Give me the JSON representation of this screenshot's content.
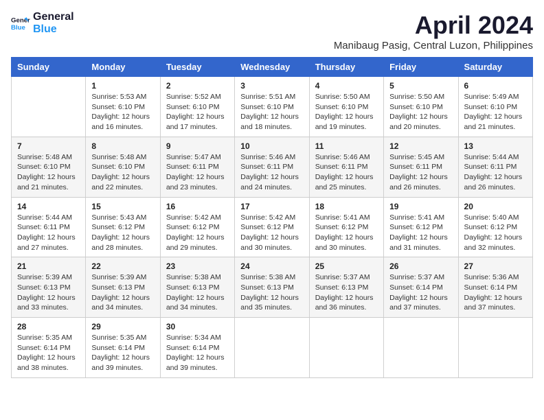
{
  "logo": {
    "line1": "General",
    "line2": "Blue"
  },
  "title": "April 2024",
  "subtitle": "Manibaug Pasig, Central Luzon, Philippines",
  "days_header": [
    "Sunday",
    "Monday",
    "Tuesday",
    "Wednesday",
    "Thursday",
    "Friday",
    "Saturday"
  ],
  "weeks": [
    [
      {
        "day": "",
        "sunrise": "",
        "sunset": "",
        "daylight": ""
      },
      {
        "day": "1",
        "sunrise": "Sunrise: 5:53 AM",
        "sunset": "Sunset: 6:10 PM",
        "daylight": "Daylight: 12 hours and 16 minutes."
      },
      {
        "day": "2",
        "sunrise": "Sunrise: 5:52 AM",
        "sunset": "Sunset: 6:10 PM",
        "daylight": "Daylight: 12 hours and 17 minutes."
      },
      {
        "day": "3",
        "sunrise": "Sunrise: 5:51 AM",
        "sunset": "Sunset: 6:10 PM",
        "daylight": "Daylight: 12 hours and 18 minutes."
      },
      {
        "day": "4",
        "sunrise": "Sunrise: 5:50 AM",
        "sunset": "Sunset: 6:10 PM",
        "daylight": "Daylight: 12 hours and 19 minutes."
      },
      {
        "day": "5",
        "sunrise": "Sunrise: 5:50 AM",
        "sunset": "Sunset: 6:10 PM",
        "daylight": "Daylight: 12 hours and 20 minutes."
      },
      {
        "day": "6",
        "sunrise": "Sunrise: 5:49 AM",
        "sunset": "Sunset: 6:10 PM",
        "daylight": "Daylight: 12 hours and 21 minutes."
      }
    ],
    [
      {
        "day": "7",
        "sunrise": "Sunrise: 5:48 AM",
        "sunset": "Sunset: 6:10 PM",
        "daylight": "Daylight: 12 hours and 21 minutes."
      },
      {
        "day": "8",
        "sunrise": "Sunrise: 5:48 AM",
        "sunset": "Sunset: 6:10 PM",
        "daylight": "Daylight: 12 hours and 22 minutes."
      },
      {
        "day": "9",
        "sunrise": "Sunrise: 5:47 AM",
        "sunset": "Sunset: 6:11 PM",
        "daylight": "Daylight: 12 hours and 23 minutes."
      },
      {
        "day": "10",
        "sunrise": "Sunrise: 5:46 AM",
        "sunset": "Sunset: 6:11 PM",
        "daylight": "Daylight: 12 hours and 24 minutes."
      },
      {
        "day": "11",
        "sunrise": "Sunrise: 5:46 AM",
        "sunset": "Sunset: 6:11 PM",
        "daylight": "Daylight: 12 hours and 25 minutes."
      },
      {
        "day": "12",
        "sunrise": "Sunrise: 5:45 AM",
        "sunset": "Sunset: 6:11 PM",
        "daylight": "Daylight: 12 hours and 26 minutes."
      },
      {
        "day": "13",
        "sunrise": "Sunrise: 5:44 AM",
        "sunset": "Sunset: 6:11 PM",
        "daylight": "Daylight: 12 hours and 26 minutes."
      }
    ],
    [
      {
        "day": "14",
        "sunrise": "Sunrise: 5:44 AM",
        "sunset": "Sunset: 6:11 PM",
        "daylight": "Daylight: 12 hours and 27 minutes."
      },
      {
        "day": "15",
        "sunrise": "Sunrise: 5:43 AM",
        "sunset": "Sunset: 6:12 PM",
        "daylight": "Daylight: 12 hours and 28 minutes."
      },
      {
        "day": "16",
        "sunrise": "Sunrise: 5:42 AM",
        "sunset": "Sunset: 6:12 PM",
        "daylight": "Daylight: 12 hours and 29 minutes."
      },
      {
        "day": "17",
        "sunrise": "Sunrise: 5:42 AM",
        "sunset": "Sunset: 6:12 PM",
        "daylight": "Daylight: 12 hours and 30 minutes."
      },
      {
        "day": "18",
        "sunrise": "Sunrise: 5:41 AM",
        "sunset": "Sunset: 6:12 PM",
        "daylight": "Daylight: 12 hours and 30 minutes."
      },
      {
        "day": "19",
        "sunrise": "Sunrise: 5:41 AM",
        "sunset": "Sunset: 6:12 PM",
        "daylight": "Daylight: 12 hours and 31 minutes."
      },
      {
        "day": "20",
        "sunrise": "Sunrise: 5:40 AM",
        "sunset": "Sunset: 6:12 PM",
        "daylight": "Daylight: 12 hours and 32 minutes."
      }
    ],
    [
      {
        "day": "21",
        "sunrise": "Sunrise: 5:39 AM",
        "sunset": "Sunset: 6:13 PM",
        "daylight": "Daylight: 12 hours and 33 minutes."
      },
      {
        "day": "22",
        "sunrise": "Sunrise: 5:39 AM",
        "sunset": "Sunset: 6:13 PM",
        "daylight": "Daylight: 12 hours and 34 minutes."
      },
      {
        "day": "23",
        "sunrise": "Sunrise: 5:38 AM",
        "sunset": "Sunset: 6:13 PM",
        "daylight": "Daylight: 12 hours and 34 minutes."
      },
      {
        "day": "24",
        "sunrise": "Sunrise: 5:38 AM",
        "sunset": "Sunset: 6:13 PM",
        "daylight": "Daylight: 12 hours and 35 minutes."
      },
      {
        "day": "25",
        "sunrise": "Sunrise: 5:37 AM",
        "sunset": "Sunset: 6:13 PM",
        "daylight": "Daylight: 12 hours and 36 minutes."
      },
      {
        "day": "26",
        "sunrise": "Sunrise: 5:37 AM",
        "sunset": "Sunset: 6:14 PM",
        "daylight": "Daylight: 12 hours and 37 minutes."
      },
      {
        "day": "27",
        "sunrise": "Sunrise: 5:36 AM",
        "sunset": "Sunset: 6:14 PM",
        "daylight": "Daylight: 12 hours and 37 minutes."
      }
    ],
    [
      {
        "day": "28",
        "sunrise": "Sunrise: 5:35 AM",
        "sunset": "Sunset: 6:14 PM",
        "daylight": "Daylight: 12 hours and 38 minutes."
      },
      {
        "day": "29",
        "sunrise": "Sunrise: 5:35 AM",
        "sunset": "Sunset: 6:14 PM",
        "daylight": "Daylight: 12 hours and 39 minutes."
      },
      {
        "day": "30",
        "sunrise": "Sunrise: 5:34 AM",
        "sunset": "Sunset: 6:14 PM",
        "daylight": "Daylight: 12 hours and 39 minutes."
      },
      {
        "day": "",
        "sunrise": "",
        "sunset": "",
        "daylight": ""
      },
      {
        "day": "",
        "sunrise": "",
        "sunset": "",
        "daylight": ""
      },
      {
        "day": "",
        "sunrise": "",
        "sunset": "",
        "daylight": ""
      },
      {
        "day": "",
        "sunrise": "",
        "sunset": "",
        "daylight": ""
      }
    ]
  ]
}
